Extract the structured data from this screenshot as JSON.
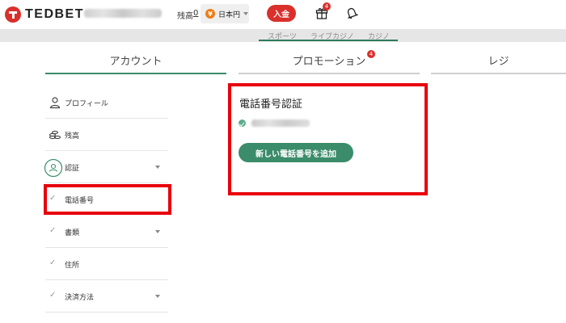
{
  "header": {
    "logo_text": "TEDBET",
    "balance_label": "残高",
    "balance_value": "0",
    "currency_symbol": "¥",
    "currency_label": "日本円",
    "deposit_label": "入金",
    "notification_count": "4"
  },
  "subnav": {
    "items": [
      "スポーツ",
      "ライブカジノ",
      "カジノ"
    ]
  },
  "tabs": [
    {
      "label": "アカウント",
      "active": true
    },
    {
      "label": "プロモーション",
      "badge": "4"
    },
    {
      "label": "レジ"
    }
  ],
  "sidebar": {
    "items": [
      {
        "label": "プロフィール",
        "icon": "user-icon"
      },
      {
        "label": "残高",
        "icon": "coins-icon"
      },
      {
        "label": "認証",
        "icon": "verification-icon",
        "expandable": true
      },
      {
        "label": "電話番号",
        "icon": "check-icon",
        "selected": true
      },
      {
        "label": "書類",
        "icon": "check-icon",
        "expandable": true
      },
      {
        "label": "住所",
        "icon": "check-icon"
      },
      {
        "label": "決済方法",
        "icon": "check-icon",
        "expandable": true
      }
    ]
  },
  "verification": {
    "title": "電話番号認証",
    "add_button": "新しい電話番号を追加"
  },
  "colors": {
    "brand_red": "#d9302c",
    "accent_green": "#3b8c6a",
    "highlight_red": "#e8000b"
  }
}
